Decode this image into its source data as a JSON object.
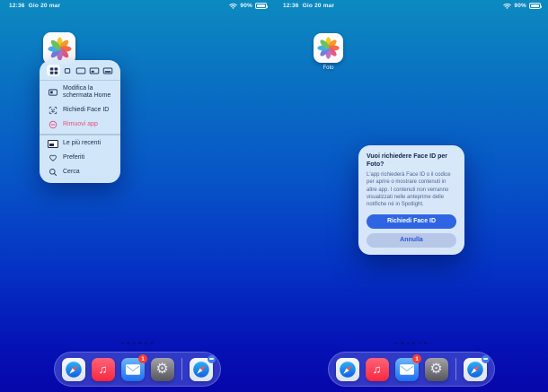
{
  "status_bar": {
    "time": "12:36",
    "date": "Gio 20 mar",
    "battery_percent": "90%"
  },
  "left_screen": {
    "app": "photos-app-icon",
    "context_menu": {
      "window_controls": [
        "grid",
        "window",
        "fullscreen",
        "split-view",
        "slide-over"
      ],
      "edit_home_label": "Modifica la schermata Home",
      "require_face_id_label": "Richiedi Face ID",
      "remove_app_label": "Rimuovi app",
      "recents_label": "Le più recenti",
      "favorites_label": "Preferiti",
      "search_label": "Cerca"
    }
  },
  "right_screen": {
    "app": "photos-app-icon",
    "app_label": "Foto",
    "dialog": {
      "title": "Vuoi richiedere Face ID per Foto?",
      "body": "L'app richiederà Face ID o il codice per aprire o mostrare contenuti in altre app. I contenuti non verranno visualizzati nelle anteprime delle notifiche né in Spotlight.",
      "primary_button": "Richiedi Face ID",
      "cancel_button": "Annulla"
    }
  },
  "dock": {
    "icons": [
      "safari-icon",
      "music-icon",
      "mail-icon",
      "settings-icon",
      "safari-icon"
    ],
    "mail_badge": "1"
  },
  "colors": {
    "bg_top": "#0c8ac0",
    "bg_bottom": "#0707aa",
    "accent_blue": "#2f65e3",
    "destructive_pink": "#e8507f",
    "menu_bg": "#d8eafa",
    "badge_red": "#ff3b30"
  }
}
